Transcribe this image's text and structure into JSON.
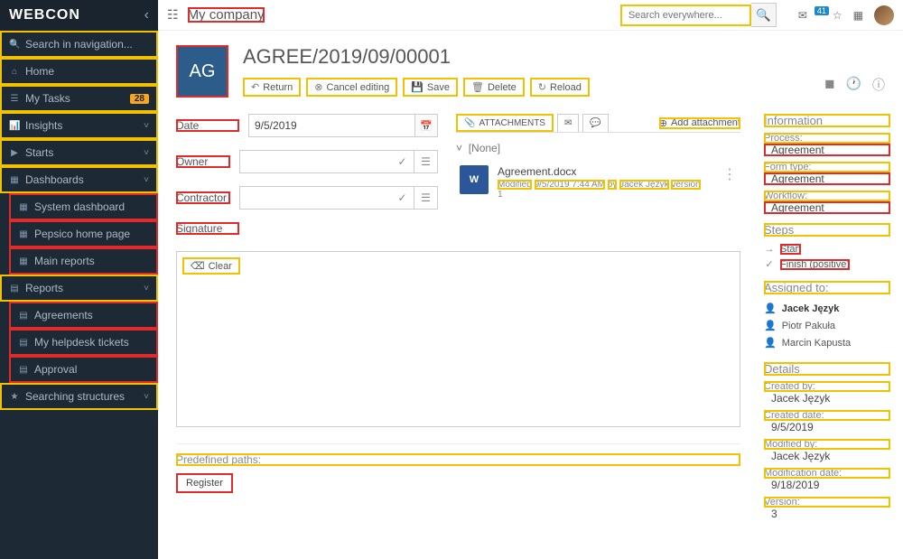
{
  "sidebar": {
    "logo": "WEBCON",
    "search_placeholder": "Search in navigation...",
    "home": "Home",
    "my_tasks": "My Tasks",
    "my_tasks_badge": "28",
    "insights": "Insights",
    "starts": "Starts",
    "dashboards": "Dashboards",
    "system_dashboard": "System dashboard",
    "pepsico": "Pepsico home page",
    "main_reports": "Main reports",
    "reports": "Reports",
    "agreements": "Agreements",
    "helpdesk": "My helpdesk tickets",
    "approval": "Approval",
    "searching": "Searching structures"
  },
  "topbar": {
    "company": "My company",
    "search_placeholder": "Search everywhere...",
    "notif_count": "41"
  },
  "header": {
    "tile": "AG",
    "title": "AGREE/2019/09/00001",
    "return": "Return",
    "cancel": "Cancel editing",
    "save": "Save",
    "delete": "Delete",
    "reload": "Reload"
  },
  "form": {
    "date_label": "Date",
    "date_value": "9/5/2019",
    "owner_label": "Owner",
    "contractor_label": "Contractor",
    "signature_label": "Signature",
    "clear": "Clear"
  },
  "attachments": {
    "tab_label": "ATTACHMENTS",
    "add": "Add attachment",
    "group": "[None]",
    "file_name": "Agreement.docx",
    "file_modified_prefix": "Modified",
    "file_modified_date": "9/5/2019 7:44 AM",
    "file_modified_by_prefix": "by",
    "file_modified_by": "Jacek Język",
    "file_version_label": "version",
    "file_version": "1"
  },
  "paths": {
    "label": "Predefined paths:",
    "register": "Register"
  },
  "info": {
    "heading": "Information",
    "process_label": "Process:",
    "process_value": "Agreement",
    "formtype_label": "Form type:",
    "formtype_value": "Agreement",
    "workflow_label": "Workflow:",
    "workflow_value": "Agreement",
    "steps_heading": "Steps",
    "step_start": "Start",
    "step_finish": "Finish (positive)",
    "assigned_heading": "Assigned to:",
    "assignees": [
      "Jacek Język",
      "Piotr Pakuła",
      "Marcin Kapusta"
    ],
    "details_heading": "Details",
    "created_by_label": "Created by:",
    "created_by": "Jacek Język",
    "created_date_label": "Created date:",
    "created_date": "9/5/2019",
    "modified_by_label": "Modified by:",
    "modified_by": "Jacek Język",
    "mod_date_label": "Modification date:",
    "mod_date": "9/18/2019",
    "version_label": "Version:",
    "version": "3"
  }
}
